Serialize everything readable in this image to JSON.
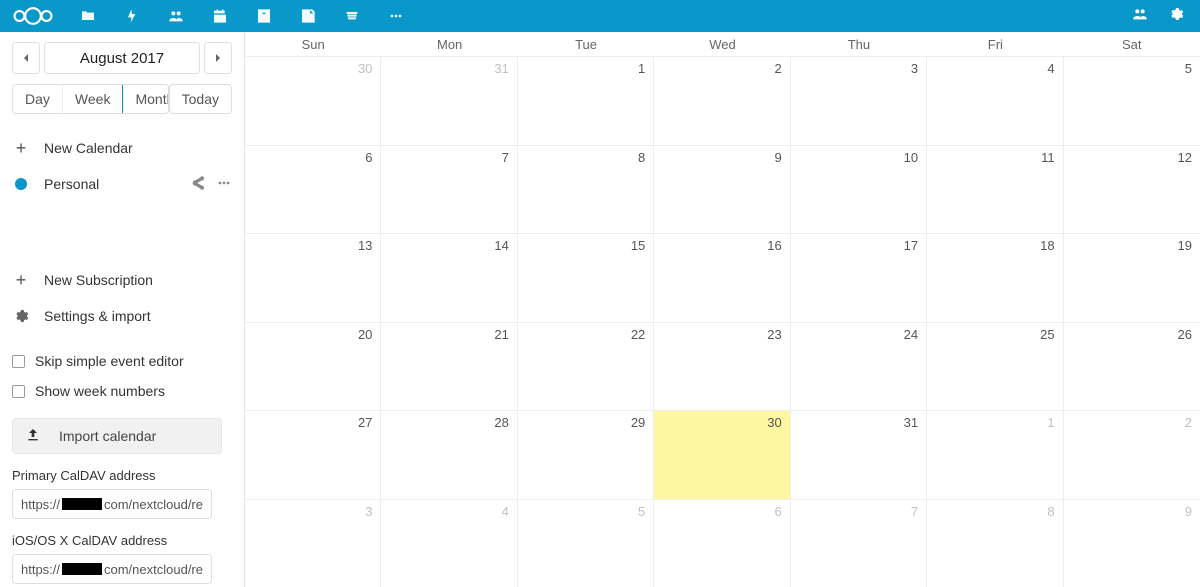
{
  "topbar": {
    "nav_icons": [
      "folder-icon",
      "activity-icon",
      "contacts-icon",
      "calendar-icon",
      "app-icon",
      "notes-icon",
      "deck-icon",
      "more-icon"
    ],
    "active_nav": "calendar-icon"
  },
  "sidebar": {
    "month_label": "August 2017",
    "view": {
      "day": "Day",
      "week": "Week",
      "month": "Month",
      "today": "Today",
      "active": "month"
    },
    "new_calendar": "New Calendar",
    "calendars": [
      {
        "name": "Personal",
        "color": "#0a97c9"
      }
    ],
    "new_subscription": "New Subscription",
    "settings_import": "Settings & import",
    "skip_simple": "Skip simple event editor",
    "week_numbers": "Show week numbers",
    "import_calendar": "Import calendar",
    "primary_label": "Primary CalDAV address",
    "primary_url_prefix": "https://",
    "primary_url_suffix": "com/nextcloud/re",
    "ios_label": "iOS/OS X CalDAV address",
    "ios_url_prefix": "https://",
    "ios_url_suffix": "com/nextcloud/re"
  },
  "calendar": {
    "day_names": [
      "Sun",
      "Mon",
      "Tue",
      "Wed",
      "Thu",
      "Fri",
      "Sat"
    ],
    "weeks": [
      [
        {
          "n": 30,
          "dim": true
        },
        {
          "n": 31,
          "dim": true
        },
        {
          "n": 1
        },
        {
          "n": 2
        },
        {
          "n": 3
        },
        {
          "n": 4
        },
        {
          "n": 5
        }
      ],
      [
        {
          "n": 6
        },
        {
          "n": 7
        },
        {
          "n": 8
        },
        {
          "n": 9
        },
        {
          "n": 10
        },
        {
          "n": 11
        },
        {
          "n": 12
        }
      ],
      [
        {
          "n": 13
        },
        {
          "n": 14
        },
        {
          "n": 15
        },
        {
          "n": 16
        },
        {
          "n": 17
        },
        {
          "n": 18
        },
        {
          "n": 19
        }
      ],
      [
        {
          "n": 20
        },
        {
          "n": 21
        },
        {
          "n": 22
        },
        {
          "n": 23
        },
        {
          "n": 24
        },
        {
          "n": 25
        },
        {
          "n": 26
        }
      ],
      [
        {
          "n": 27
        },
        {
          "n": 28
        },
        {
          "n": 29
        },
        {
          "n": 30,
          "today": true
        },
        {
          "n": 31
        },
        {
          "n": 1,
          "dim": true
        },
        {
          "n": 2,
          "dim": true
        }
      ],
      [
        {
          "n": 3,
          "dim": true
        },
        {
          "n": 4,
          "dim": true
        },
        {
          "n": 5,
          "dim": true
        },
        {
          "n": 6,
          "dim": true
        },
        {
          "n": 7,
          "dim": true
        },
        {
          "n": 8,
          "dim": true
        },
        {
          "n": 9,
          "dim": true
        }
      ]
    ]
  }
}
